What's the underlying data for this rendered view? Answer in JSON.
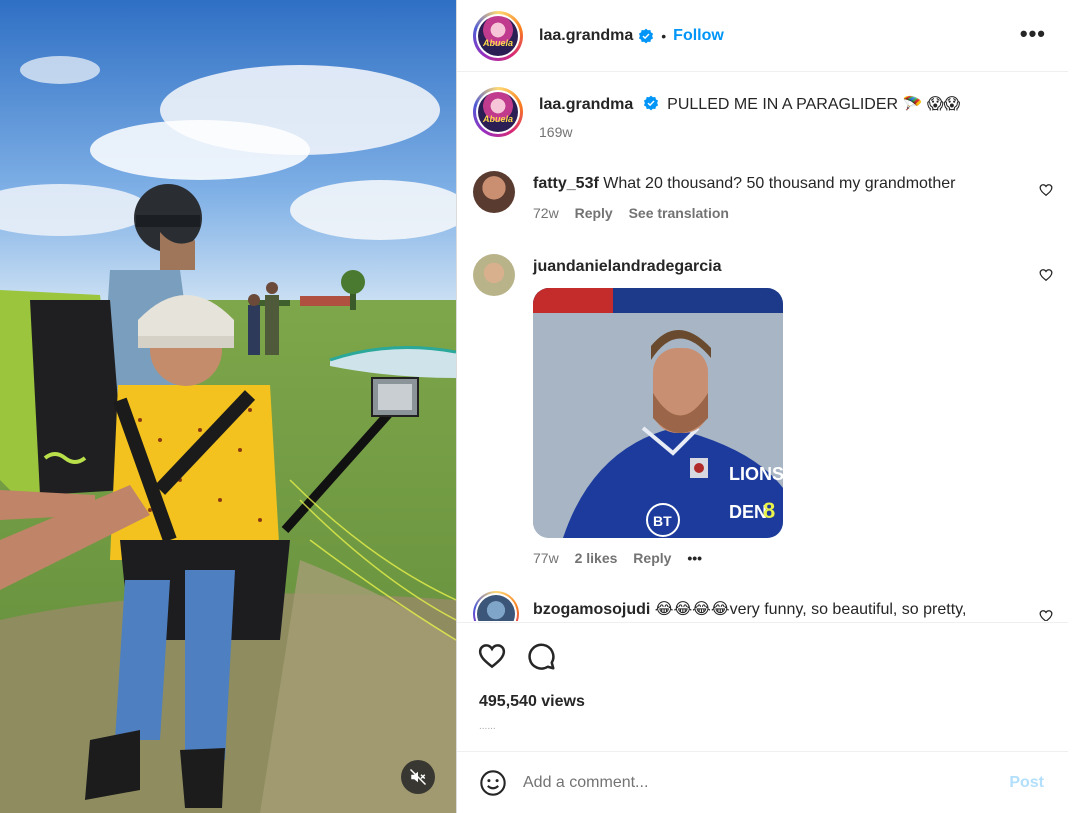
{
  "post": {
    "username": "laa.grandma",
    "follow_label": "Follow",
    "separator": "•",
    "more_label": "•••",
    "avatar_text": "Abuela",
    "caption": {
      "username": "laa.grandma",
      "text": "PULLED ME IN A PARAGLIDER 🪂 😱😱",
      "time": "169w"
    }
  },
  "comments": [
    {
      "username": "fatty_53f",
      "text": "What 20 thousand? 50 thousand my grandmother",
      "time": "72w",
      "reply_label": "Reply",
      "translate_label": "See translation"
    },
    {
      "username": "juandanielandradegarcia",
      "text": "",
      "gif_text_top": "LIONS",
      "gif_text_bottom": "DEN",
      "gif_number": "8",
      "gif_sponsor": "BT",
      "time": "77w",
      "likes": "2 likes",
      "reply_label": "Reply",
      "more_label": "•••"
    },
    {
      "username": "bzogamosojudi",
      "text": "😂😂😂😂very funny, so beautiful, so pretty,"
    }
  ],
  "actions": {
    "views": "495,540 views",
    "timeago": "......"
  },
  "add_comment": {
    "placeholder": "Add a comment...",
    "post_label": "Post"
  },
  "colors": {
    "link_blue": "#0095f6",
    "post_disabled": "#b2dffc",
    "secondary_text": "#737373"
  }
}
